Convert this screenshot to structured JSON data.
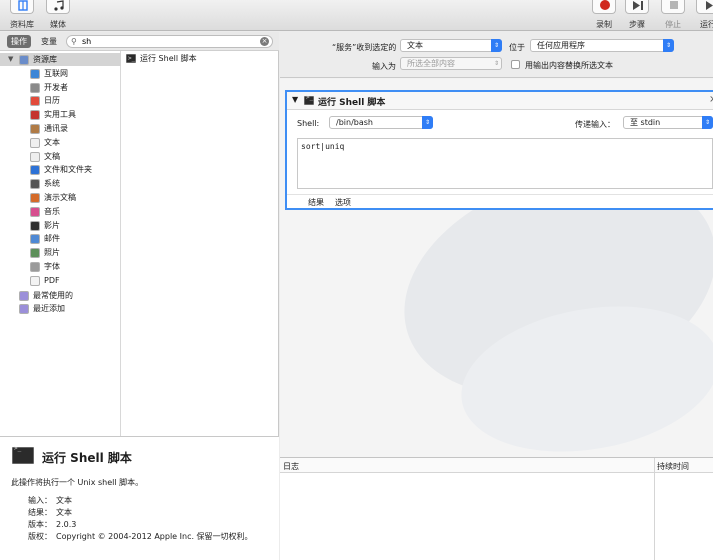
{
  "toolbar": {
    "library_label": "资料库",
    "media_label": "媒体",
    "record_label": "录制",
    "step_label": "步骤",
    "stop_label": "停止",
    "run_label": "运行"
  },
  "left": {
    "segment_actions": "操作",
    "segment_variables": "变量",
    "search_value": "sh",
    "library_items": [
      {
        "label": "资源库",
        "color": "#6a8cc9"
      },
      {
        "label": "互联网",
        "color": "#3d86d6"
      },
      {
        "label": "开发者",
        "color": "#8a8a8a"
      },
      {
        "label": "日历",
        "color": "#e24b3b"
      },
      {
        "label": "实用工具",
        "color": "#c4352f"
      },
      {
        "label": "通讯录",
        "color": "#b07b46"
      },
      {
        "label": "文本",
        "color": "#f0f0f0"
      },
      {
        "label": "文稿",
        "color": "#eeeeee"
      },
      {
        "label": "文件和文件夹",
        "color": "#2d72d6"
      },
      {
        "label": "系统",
        "color": "#555555"
      },
      {
        "label": "演示文稿",
        "color": "#d46b2a"
      },
      {
        "label": "音乐",
        "color": "#d74f8f"
      },
      {
        "label": "影片",
        "color": "#2f2f2f"
      },
      {
        "label": "邮件",
        "color": "#4f89d4"
      },
      {
        "label": "照片",
        "color": "#5d8f5a"
      },
      {
        "label": "字体",
        "color": "#9a9a9a"
      },
      {
        "label": "PDF",
        "color": "#f3f3f3"
      },
      {
        "label": "最常使用的",
        "color": "#9b8fd9"
      },
      {
        "label": "最近添加",
        "color": "#9b8fd9"
      }
    ],
    "actions": [
      {
        "label": "运行 Shell 脚本"
      }
    ],
    "description": {
      "title": "运行 Shell 脚本",
      "text": "此操作将执行一个 Unix shell 脚本。",
      "input_key": "输入：",
      "input_value": "文本",
      "result_key": "结果：",
      "result_value": "文本",
      "version_key": "版本：",
      "version_value": "2.0.3",
      "copyright_key": "版权：",
      "copyright_value": "Copyright © 2004-2012 Apple Inc. 保留一切权利。"
    }
  },
  "config": {
    "service_label": "“服务”收到选定的",
    "service_value": "文本",
    "position_label": "位于",
    "position_value": "任何应用程序",
    "input_label": "输入为",
    "input_value": "所选全部内容",
    "replace_label": "用输出内容替换所选文本"
  },
  "card": {
    "title": "运行 Shell 脚本",
    "shell_label": "Shell:",
    "shell_value": "/bin/bash",
    "pass_label": "传递输入：",
    "pass_value": "至 stdin",
    "script": "sort|uniq",
    "tab_results": "结果",
    "tab_options": "选项"
  },
  "log": {
    "header": "日志",
    "duration": "持续时间"
  }
}
